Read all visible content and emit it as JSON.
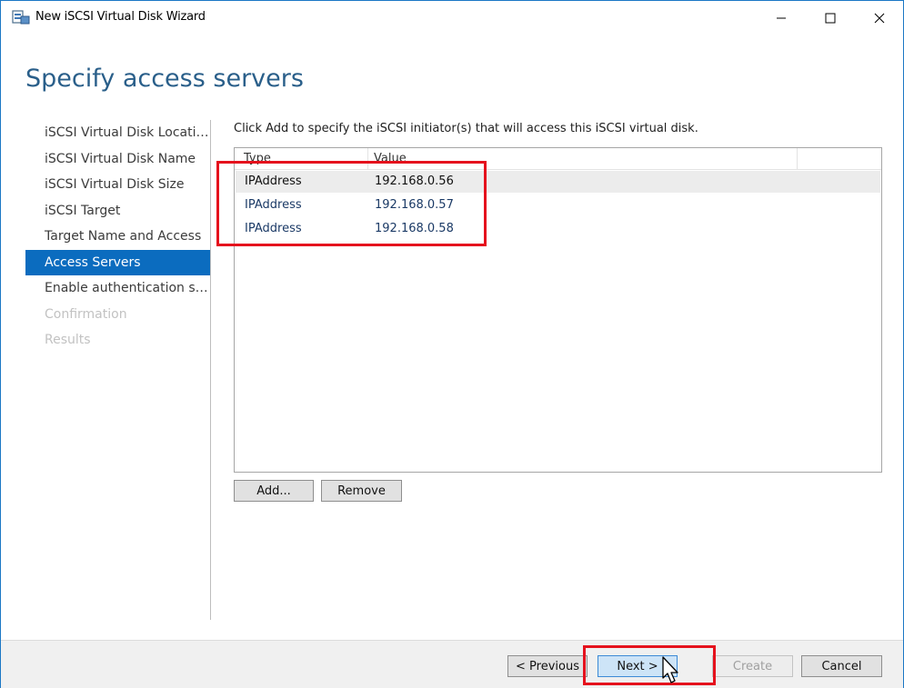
{
  "window": {
    "title": "New iSCSI Virtual Disk Wizard"
  },
  "page": {
    "heading": "Specify access servers",
    "instruction": "Click Add to specify the iSCSI initiator(s) that will access this iSCSI virtual disk."
  },
  "nav": {
    "items": [
      {
        "label": "iSCSI Virtual Disk Location",
        "state": "normal"
      },
      {
        "label": "iSCSI Virtual Disk Name",
        "state": "normal"
      },
      {
        "label": "iSCSI Virtual Disk Size",
        "state": "normal"
      },
      {
        "label": "iSCSI Target",
        "state": "normal"
      },
      {
        "label": "Target Name and Access",
        "state": "normal"
      },
      {
        "label": "Access Servers",
        "state": "active"
      },
      {
        "label": "Enable authentication ser...",
        "state": "normal"
      },
      {
        "label": "Confirmation",
        "state": "disabled"
      },
      {
        "label": "Results",
        "state": "disabled"
      }
    ]
  },
  "list": {
    "columns": {
      "type": "Type",
      "value": "Value"
    },
    "rows": [
      {
        "type": "IPAddress",
        "value": "192.168.0.56"
      },
      {
        "type": "IPAddress",
        "value": "192.168.0.57"
      },
      {
        "type": "IPAddress",
        "value": "192.168.0.58"
      }
    ]
  },
  "buttons": {
    "add": "Add...",
    "remove": "Remove",
    "previous": "< Previous",
    "next": "Next >",
    "create": "Create",
    "cancel": "Cancel"
  },
  "colors": {
    "accent": "#0b6cbf",
    "heading": "#2a5f8a",
    "highlight": "#e5121d"
  }
}
